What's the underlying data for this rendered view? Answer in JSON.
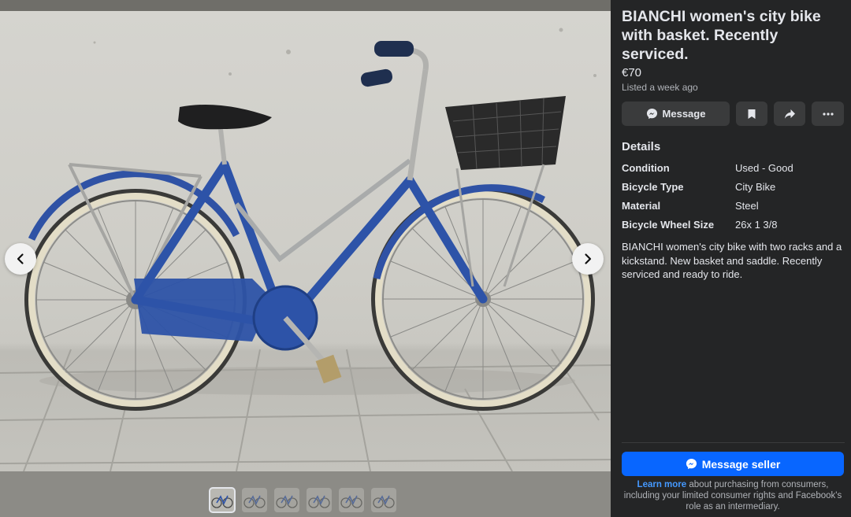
{
  "listing": {
    "title": "BIANCHI women's city bike with basket. Recently serviced.",
    "price": "€70",
    "listed": "Listed a week ago"
  },
  "actions": {
    "message_label": "Message"
  },
  "details": {
    "heading": "Details",
    "rows": [
      {
        "key": "Condition",
        "value": "Used - Good"
      },
      {
        "key": "Bicycle Type",
        "value": "City Bike"
      },
      {
        "key": "Material",
        "value": "Steel"
      },
      {
        "key": "Bicycle Wheel Size",
        "value": "26x 1 3/8"
      }
    ],
    "description": "BIANCHI women's city bike with two racks and a kickstand. New basket and saddle. Recently serviced and ready to ride."
  },
  "footer": {
    "message_seller_label": "Message seller",
    "learn_more_link": "Learn more",
    "learn_more_text": " about purchasing from consumers, including your limited consumer rights and Facebook's role as an intermediary."
  },
  "gallery": {
    "thumbnail_count": 6,
    "active_index": 0
  },
  "colors": {
    "panel_bg": "#242526",
    "accent_blue": "#0866ff",
    "link_blue": "#4599ff",
    "button_bg": "#3a3b3c"
  }
}
